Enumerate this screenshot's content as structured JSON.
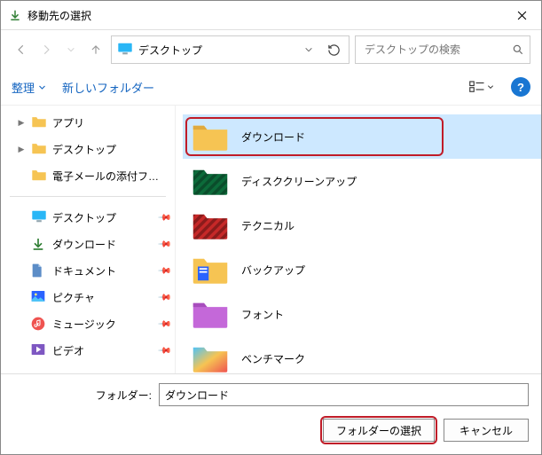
{
  "title": "移動先の選択",
  "location": {
    "label": "デスクトップ"
  },
  "search": {
    "placeholder": "デスクトップの検索"
  },
  "toolbar": {
    "organize": "整理",
    "new_folder": "新しいフォルダー"
  },
  "sidebar": {
    "tree": [
      {
        "label": "アプリ",
        "chev": true
      },
      {
        "label": "デスクトップ",
        "chev": true
      },
      {
        "label": "電子メールの添付ファイル",
        "chev": false
      }
    ],
    "pinned": [
      {
        "label": "デスクトップ",
        "icon": "desktop"
      },
      {
        "label": "ダウンロード",
        "icon": "download"
      },
      {
        "label": "ドキュメント",
        "icon": "document"
      },
      {
        "label": "ピクチャ",
        "icon": "pictures"
      },
      {
        "label": "ミュージック",
        "icon": "music"
      },
      {
        "label": "ビデオ",
        "icon": "video"
      }
    ]
  },
  "content": {
    "items": [
      {
        "label": "ダウンロード",
        "selected": true,
        "color": "#f6c453"
      },
      {
        "label": "ディスククリーンアップ",
        "selected": false,
        "color": "stripes-green"
      },
      {
        "label": "テクニカル",
        "selected": false,
        "color": "stripes-red"
      },
      {
        "label": "バックアップ",
        "selected": false,
        "color": "doc-yellow"
      },
      {
        "label": "フォント",
        "selected": false,
        "color": "#c468d9"
      },
      {
        "label": "ベンチマーク",
        "selected": false,
        "color": "gradient"
      }
    ]
  },
  "footer": {
    "folder_label": "フォルダー:",
    "folder_value": "ダウンロード",
    "select_button": "フォルダーの選択",
    "cancel_button": "キャンセル"
  }
}
